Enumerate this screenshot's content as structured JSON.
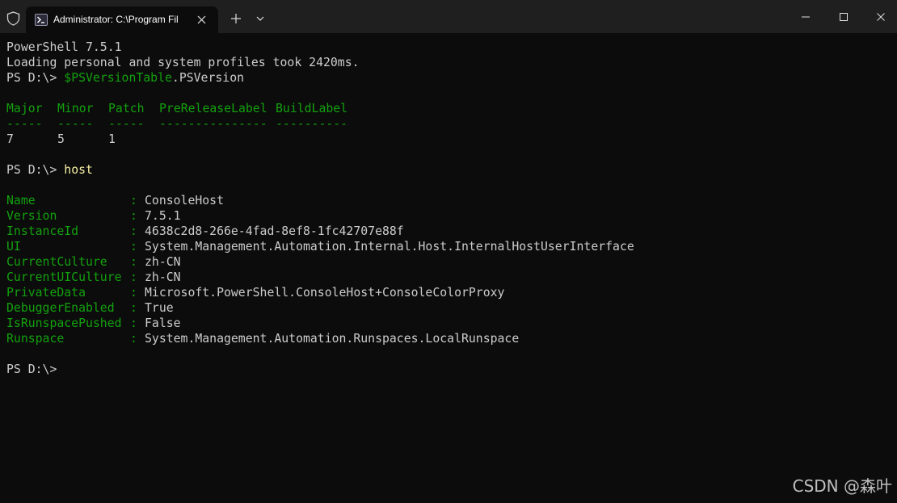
{
  "window": {
    "tab_title": "Administrator: C:\\Program Fil"
  },
  "terminal": {
    "banner_version": "PowerShell 7.5.1",
    "banner_profiles": "Loading personal and system profiles took 2420ms.",
    "prompt": "PS D:\\> ",
    "cmd1_var": "$PSVersionTable",
    "cmd1_prop": ".PSVersion",
    "version_table": {
      "headers": [
        "Major",
        "Minor",
        "Patch",
        "PreReleaseLabel",
        "BuildLabel"
      ],
      "dashes": [
        "-----",
        "-----",
        "-----",
        "---------------",
        "----------"
      ],
      "values": [
        "7",
        "5",
        "1",
        "",
        ""
      ]
    },
    "cmd2": "host",
    "host_props": [
      {
        "name": "Name",
        "value": "ConsoleHost"
      },
      {
        "name": "Version",
        "value": "7.5.1"
      },
      {
        "name": "InstanceId",
        "value": "4638c2d8-266e-4fad-8ef8-1fc42707e88f"
      },
      {
        "name": "UI",
        "value": "System.Management.Automation.Internal.Host.InternalHostUserInterface"
      },
      {
        "name": "CurrentCulture",
        "value": "zh-CN"
      },
      {
        "name": "CurrentUICulture",
        "value": "zh-CN"
      },
      {
        "name": "PrivateData",
        "value": "Microsoft.PowerShell.ConsoleHost+ConsoleColorProxy"
      },
      {
        "name": "DebuggerEnabled",
        "value": "True"
      },
      {
        "name": "IsRunspacePushed",
        "value": "False"
      },
      {
        "name": "Runspace",
        "value": "System.Management.Automation.Runspaces.LocalRunspace"
      }
    ],
    "separator": ":"
  },
  "watermark": "CSDN @森叶",
  "colors": {
    "background": "#0c0c0c",
    "titlebar": "#1f1f1f",
    "text": "#cccccc",
    "green": "#13a10e",
    "yellow": "#f9f1a5"
  },
  "icons": [
    "shield-icon",
    "powershell-icon",
    "close-icon",
    "plus-icon",
    "chevron-down-icon",
    "minimize-icon",
    "maximize-icon"
  ]
}
